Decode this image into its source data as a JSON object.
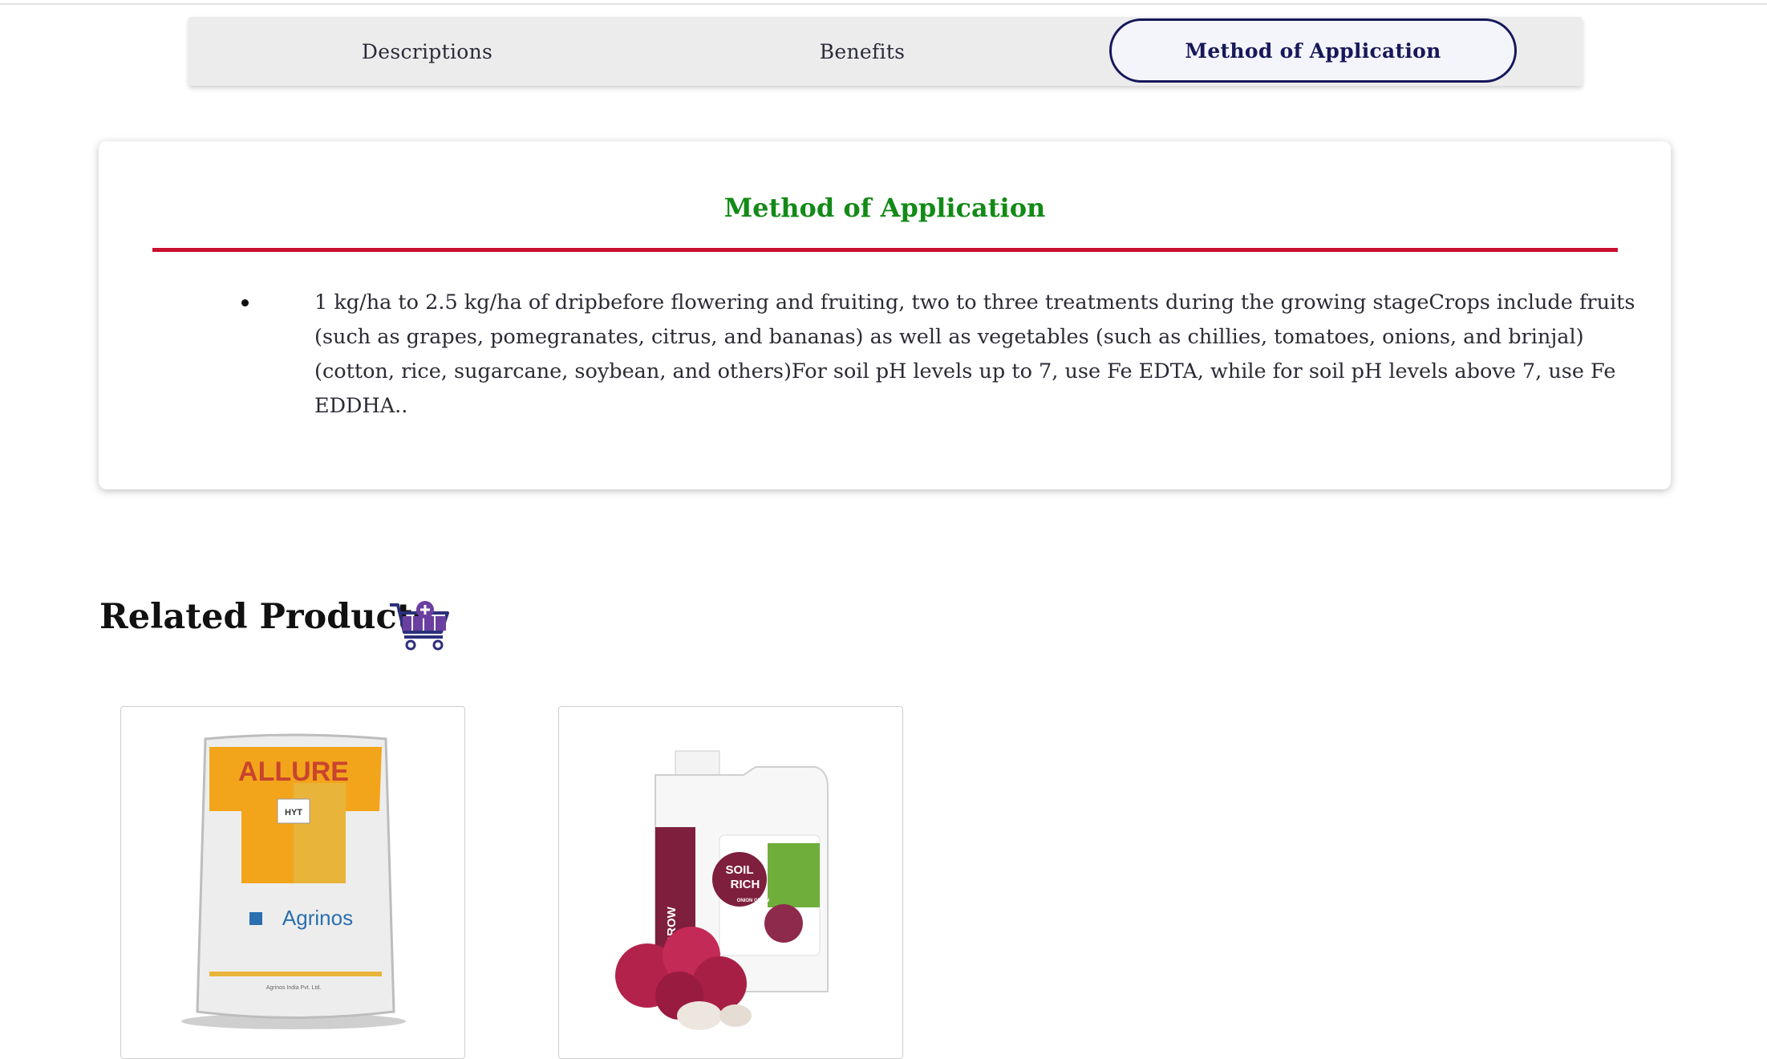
{
  "tabs": [
    {
      "label": "Descriptions",
      "active": false
    },
    {
      "label": "Benefits",
      "active": false
    },
    {
      "label": "Method of Application",
      "active": true
    }
  ],
  "section": {
    "title": "Method of Application",
    "bullets": [
      "1 kg/ha to 2.5 kg/ha of dripbefore flowering and fruiting, two to three treatments during the growing stageCrops include fruits (such as grapes, pomegranates, citrus, and bananas) as well as vegetables (such as chillies, tomatoes, onions, and brinjal) (cotton, rice, sugarcane, soybean, and others)For soil pH levels up to 7, use Fe EDTA, while for soil pH levels above 7, use Fe EDDHA.."
    ]
  },
  "related": {
    "title": "Related Products",
    "icon": "cart-plus-icon",
    "products": [
      {
        "brand": "ALLURE",
        "sub_label": "HYT",
        "maker": "Agrinos",
        "company": "Agrinos India Pvt. Ltd."
      },
      {
        "side_label": "ONION GROW",
        "brand_line1": "SOIL",
        "brand_line2": "RICH",
        "sub_label": "ONION GROW"
      }
    ]
  },
  "colors": {
    "accent_navy": "#16185a",
    "title_green": "#138a17",
    "rule_red": "#c8102e",
    "icon_purple": "#6a3fa0"
  }
}
